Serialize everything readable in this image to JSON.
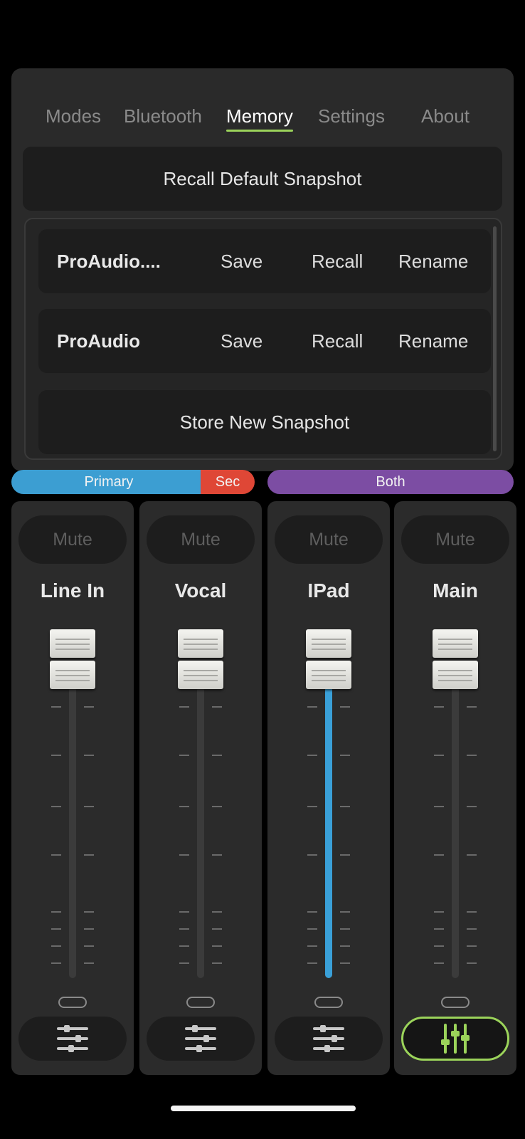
{
  "tabs": [
    {
      "label": "Modes",
      "active": false
    },
    {
      "label": "Bluetooth",
      "active": false
    },
    {
      "label": "Memory",
      "active": true
    },
    {
      "label": "Settings",
      "active": false
    },
    {
      "label": "About",
      "active": false
    }
  ],
  "memory": {
    "recall_default_label": "Recall Default Snapshot",
    "snapshots": [
      {
        "name": "ProAudio....",
        "save": "Save",
        "recall": "Recall",
        "rename": "Rename"
      },
      {
        "name": "ProAudio",
        "save": "Save",
        "recall": "Recall",
        "rename": "Rename"
      }
    ],
    "store_new_label": "Store New Snapshot"
  },
  "routing": {
    "primary": "Primary",
    "sec": "Sec",
    "both": "Both",
    "colors": {
      "primary": "#3c9ed2",
      "sec": "#df4736",
      "both": "#7c4da3"
    }
  },
  "channels": [
    {
      "name": "Line In",
      "mute": "Mute",
      "fader_level": 1.0,
      "meter_fill": 0.0,
      "eq_icon": "sliders-icon",
      "active": false
    },
    {
      "name": "Vocal",
      "mute": "Mute",
      "fader_level": 1.0,
      "meter_fill": 0.0,
      "eq_icon": "sliders-icon",
      "active": false
    },
    {
      "name": "IPad",
      "mute": "Mute",
      "fader_level": 1.0,
      "meter_fill": 1.0,
      "eq_icon": "sliders-icon",
      "active": false
    },
    {
      "name": "Main",
      "mute": "Mute",
      "fader_level": 1.0,
      "meter_fill": 0.0,
      "eq_icon": "vertical-sliders-icon",
      "active": true
    }
  ],
  "colors": {
    "accent": "#9bd35a",
    "meter": "#3aa0d8"
  }
}
